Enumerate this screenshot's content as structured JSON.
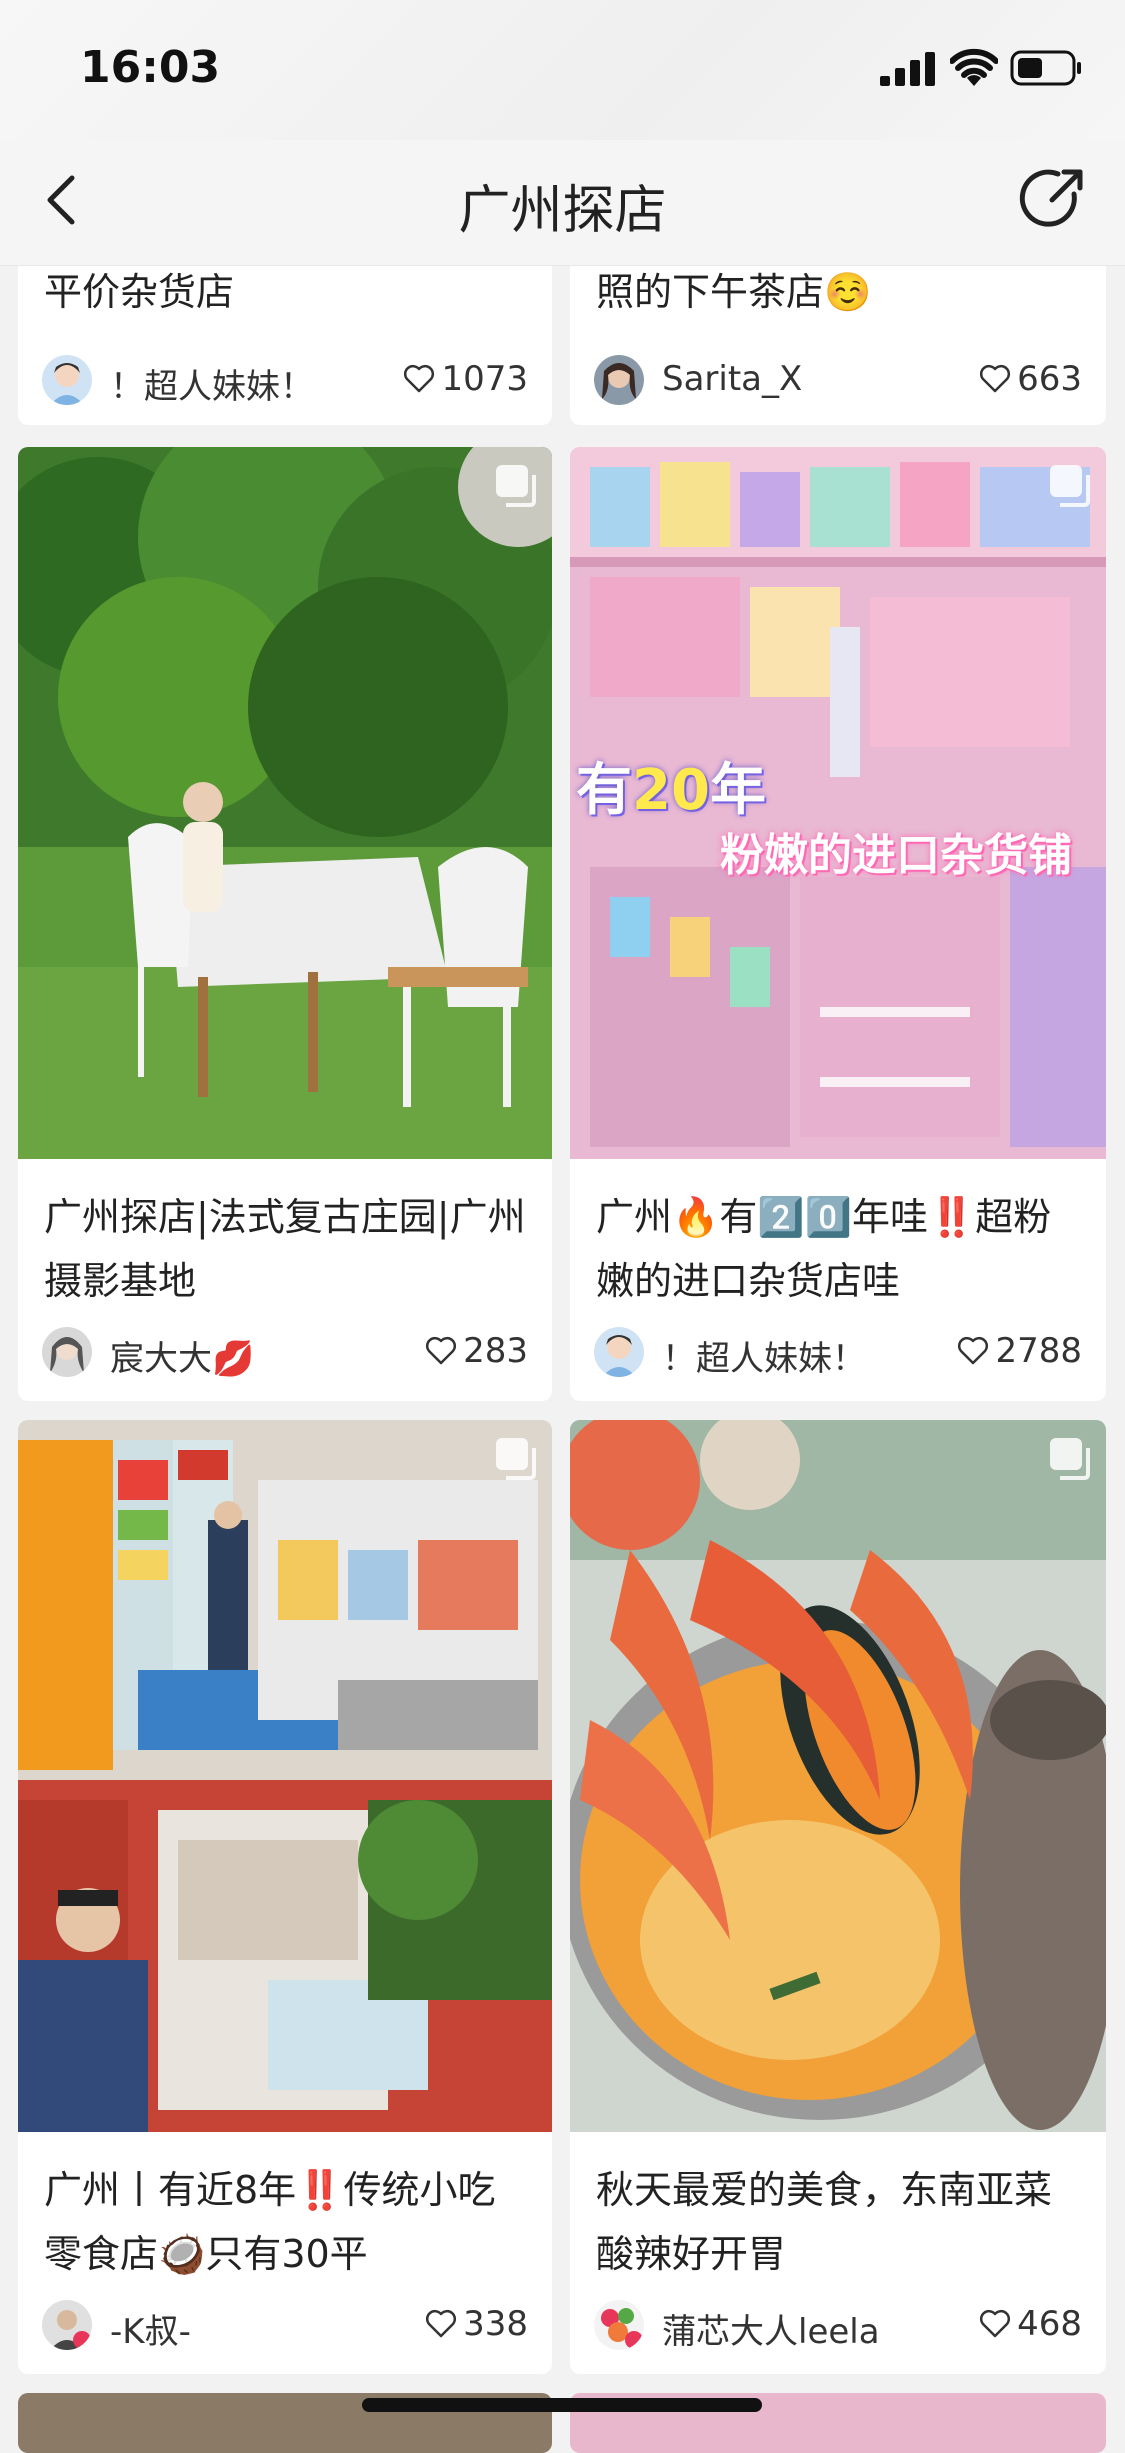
{
  "status": {
    "time": "16:03"
  },
  "nav": {
    "title": "广州探店"
  },
  "cards": [
    {
      "title": "平价杂货店",
      "author": "！超人妹妹！",
      "likes": "1073"
    },
    {
      "title": "照的下午茶店☺️",
      "author": "Sarita_X",
      "likes": "663"
    },
    {
      "title": "广州探店|法式复古庄园|广州摄影基地",
      "author": "宸大大💋",
      "likes": "283"
    },
    {
      "title": "广州🔥有2️⃣0️⃣年哇‼️超粉嫩的进口杂货店哇",
      "author": "！超人妹妹！",
      "likes": "2788",
      "overlay_line1_a": "有",
      "overlay_line1_b": "20",
      "overlay_line1_c": "年",
      "overlay_line2": "粉嫩的进口杂货铺"
    },
    {
      "title": "广州丨有近8年‼️传统小吃零食店🥥只有30平",
      "author": "-K叔-",
      "likes": "338"
    },
    {
      "title": "秋天最爱的美食，东南亚菜酸辣好开胃",
      "author": "蒲芯大人leela",
      "likes": "468"
    }
  ],
  "colors": {
    "background": "#f2f2f2",
    "card": "#ffffff"
  }
}
